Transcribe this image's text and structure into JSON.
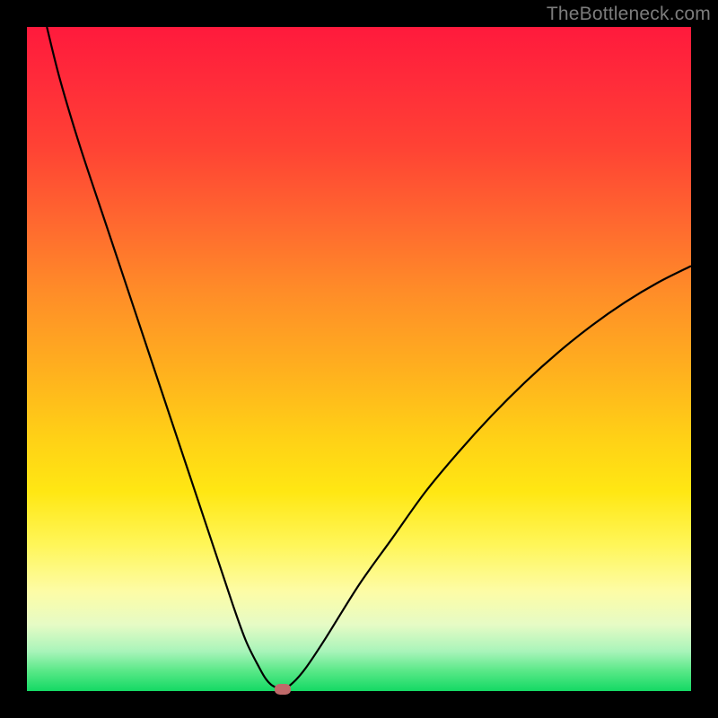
{
  "watermark": "TheBottleneck.com",
  "colors": {
    "curve_stroke": "#000000",
    "marker_fill": "#c06a6a"
  },
  "chart_data": {
    "type": "line",
    "title": "",
    "xlabel": "",
    "ylabel": "",
    "xlim": [
      0,
      100
    ],
    "ylim": [
      0,
      100
    ],
    "series": [
      {
        "name": "bottleneck-curve",
        "x": [
          3,
          5,
          8,
          12,
          16,
          20,
          24,
          28,
          31,
          33,
          35,
          36,
          37,
          38.5,
          40,
          42,
          45,
          50,
          55,
          60,
          65,
          70,
          75,
          80,
          85,
          90,
          95,
          100
        ],
        "y": [
          100,
          92,
          82,
          70,
          58,
          46,
          34,
          22,
          13,
          7.5,
          3.5,
          1.8,
          0.8,
          0.3,
          1.2,
          3.5,
          8,
          16,
          23,
          30,
          36,
          41.5,
          46.5,
          51,
          55,
          58.5,
          61.5,
          64
        ]
      }
    ],
    "marker": {
      "x": 38.5,
      "y": 0.3
    },
    "annotations": []
  }
}
